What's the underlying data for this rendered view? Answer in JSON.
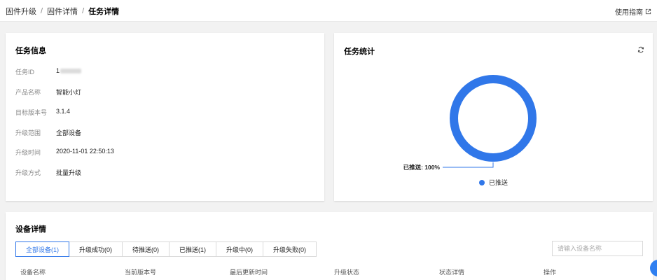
{
  "breadcrumb": {
    "items": [
      "固件升级",
      "固件详情"
    ],
    "current": "任务详情",
    "separator": "/"
  },
  "header": {
    "guide_label": "使用指南"
  },
  "task_info": {
    "title": "任务信息",
    "rows": [
      {
        "label": "任务ID",
        "value": "1"
      },
      {
        "label": "产品名称",
        "value": "智能小灯"
      },
      {
        "label": "目标版本号",
        "value": "3.1.4"
      },
      {
        "label": "升级范围",
        "value": "全部设备"
      },
      {
        "label": "升级时间",
        "value": "2020-11-01 22:50:13"
      },
      {
        "label": "升级方式",
        "value": "批量升级"
      }
    ]
  },
  "task_stats": {
    "title": "任务统计",
    "legend_label": "已推送"
  },
  "chart_data": {
    "type": "pie",
    "donut": true,
    "categories": [
      "已推送"
    ],
    "values": [
      100
    ],
    "data_label": "已推送: 100%",
    "legend_position": "bottom",
    "colors": [
      "#3077e9"
    ]
  },
  "device_details": {
    "title": "设备详情",
    "tabs": [
      {
        "label": "全部设备(1)",
        "active": true
      },
      {
        "label": "升级成功(0)",
        "active": false
      },
      {
        "label": "待推送(0)",
        "active": false
      },
      {
        "label": "已推送(1)",
        "active": false
      },
      {
        "label": "升级中(0)",
        "active": false
      },
      {
        "label": "升级失败(0)",
        "active": false
      }
    ],
    "search_placeholder": "请输入设备名称",
    "columns": [
      "设备名称",
      "当前版本号",
      "最后更新时间",
      "升级状态",
      "状态详情",
      "操作"
    ]
  },
  "colors": {
    "accent": "#3077e9",
    "float_button": "#2f7ff0"
  }
}
